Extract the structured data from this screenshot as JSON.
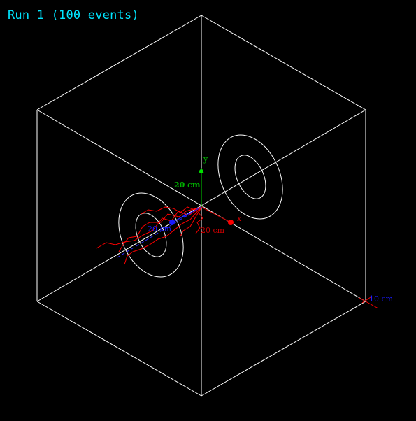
{
  "title": "Run 1 (100 events)",
  "axes": {
    "y": {
      "letter": "y",
      "length_label": "20 cm",
      "color": "#00b000"
    },
    "x": {
      "letter": "x",
      "length_label": "20 cm",
      "color": "#cc0000"
    },
    "z": {
      "letter": "z",
      "length_label": "20 cm",
      "color": "#0000cc"
    }
  },
  "scale_label": "10 cm",
  "colors": {
    "background": "#000000",
    "title": "#00e5ff",
    "geometry": "#ffffff",
    "trajectories": "#ff0000",
    "scale": "#1a1aff"
  }
}
